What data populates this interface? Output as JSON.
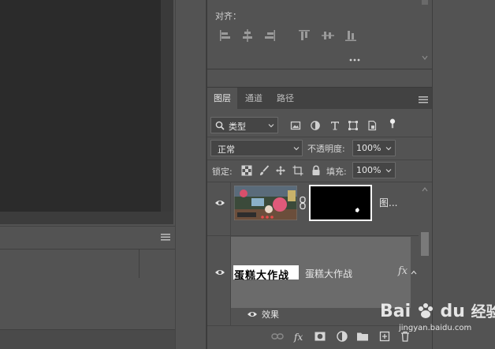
{
  "align_panel": {
    "label": "对齐："
  },
  "layers_panel": {
    "tabs": [
      "图层",
      "通道",
      "路径"
    ],
    "filter_kind": "类型",
    "blend_mode": "正常",
    "opacity_label": "不透明度:",
    "opacity_value": "100%",
    "lock_label": "锁定:",
    "fill_label": "填充:",
    "fill_value": "100%",
    "layers": [
      {
        "name": "图...",
        "visible": true
      },
      {
        "name": "蛋糕大作战",
        "visible": true,
        "has_fx": true,
        "fx_label": "fx",
        "text_thumb": "蛋糕大作战"
      }
    ],
    "effects_label": "效果"
  },
  "watermark": {
    "brand": "Bai",
    "brand2": "du",
    "jingyan": "经验",
    "url": "jingyan.baidu.com"
  },
  "icons": {
    "menu": "hamburger-icon",
    "more": "ellipsis-icon"
  }
}
